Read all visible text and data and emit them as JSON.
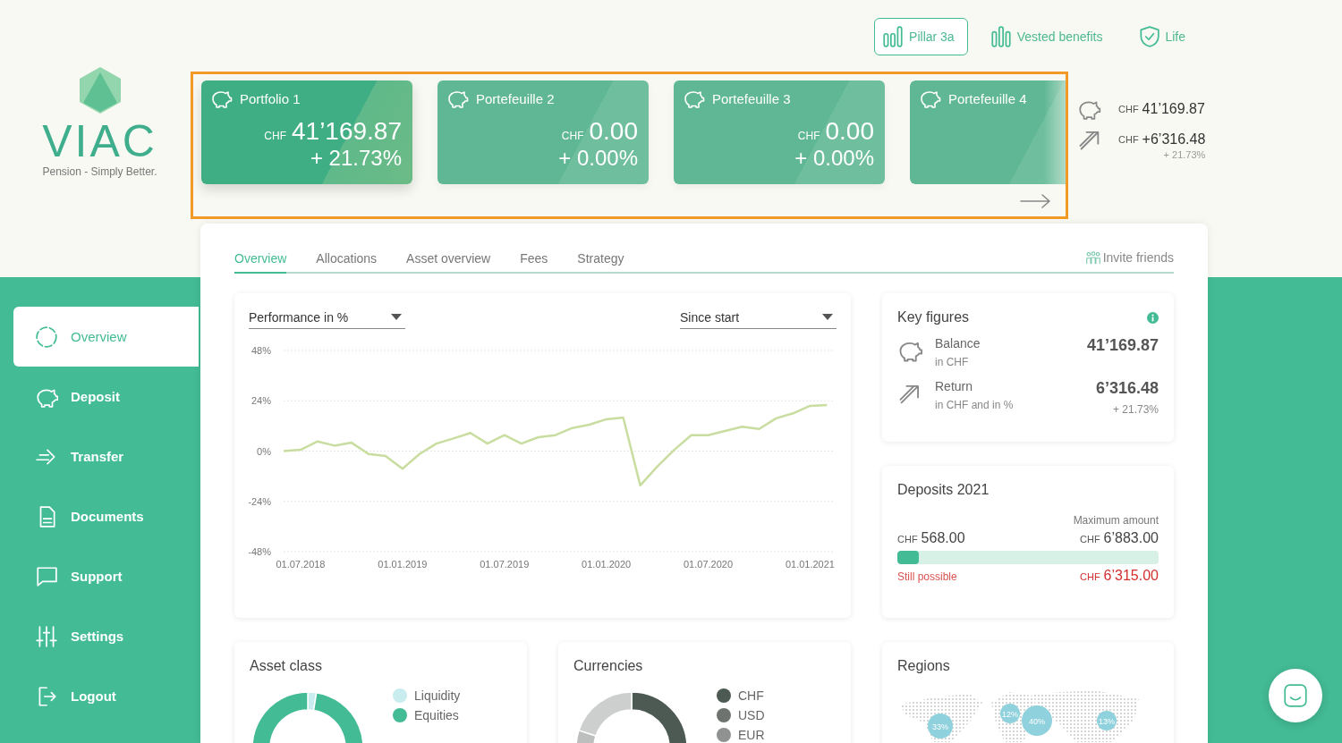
{
  "products": [
    {
      "label": "Pillar 3a",
      "kind": "pillar",
      "selected": true
    },
    {
      "label": "Vested benefits",
      "kind": "vested",
      "selected": false
    },
    {
      "label": "Life",
      "kind": "life",
      "selected": false
    }
  ],
  "logo": {
    "name": "VIAC",
    "tagline": "Pension - Simply Better."
  },
  "portfolios": [
    {
      "name": "Portfolio 1",
      "currency": "CHF",
      "amount": "41’169.87",
      "change": "+ 21.73%",
      "selected": true
    },
    {
      "name": "Portefeuille 2",
      "currency": "CHF",
      "amount": "0.00",
      "change": "+ 0.00%",
      "selected": false
    },
    {
      "name": "Portefeuille 3",
      "currency": "CHF",
      "amount": "0.00",
      "change": "+ 0.00%",
      "selected": false
    },
    {
      "name": "Portefeuille 4",
      "selected": false
    }
  ],
  "summary": {
    "balance_currency": "CHF",
    "balance": "41’169.87",
    "return_currency": "CHF",
    "return": "+6’316.48",
    "return_percent": "+ 21.73%"
  },
  "sidebar": {
    "items": [
      {
        "label": "Overview",
        "selected": true
      },
      {
        "label": "Deposit",
        "selected": false
      },
      {
        "label": "Transfer",
        "selected": false
      },
      {
        "label": "Documents",
        "selected": false
      },
      {
        "label": "Support",
        "selected": false
      },
      {
        "label": "Settings",
        "selected": false
      },
      {
        "label": "Logout",
        "selected": false
      }
    ]
  },
  "tabs": [
    {
      "label": "Overview",
      "selected": true
    },
    {
      "label": "Allocations",
      "selected": false
    },
    {
      "label": "Asset overview",
      "selected": false
    },
    {
      "label": "Fees",
      "selected": false
    },
    {
      "label": "Strategy",
      "selected": false
    }
  ],
  "invite": "Invite friends",
  "performance": {
    "metric": "Performance in %",
    "period": "Since start",
    "chart_data": {
      "type": "line",
      "categories": [
        null,
        "01.07.2018",
        null,
        null,
        null,
        null,
        null,
        "01.01.2019",
        null,
        null,
        null,
        null,
        null,
        "01.07.2019",
        null,
        null,
        null,
        null,
        null,
        "01.01.2020",
        null,
        null,
        null,
        null,
        null,
        "01.07.2020",
        null,
        null,
        null,
        null,
        null,
        "01.01.2021",
        null
      ],
      "series": [
        {
          "color": "#c8dd9f",
          "values": [
            0,
            0.6,
            4.6,
            2.6,
            4,
            -1.4,
            -2.4,
            -8.4,
            -1.4,
            3.6,
            6,
            8.6,
            3.6,
            7.6,
            3.6,
            6.6,
            7.6,
            11,
            12.6,
            15.2,
            16,
            -16.4,
            -7.4,
            0.6,
            7.6,
            7.6,
            9.6,
            11.6,
            10.6,
            15.6,
            18,
            21.6,
            22
          ]
        }
      ],
      "ylim": [
        -48,
        48
      ],
      "grid": true,
      "yticks": [
        {
          "value": 48,
          "label": "48%"
        },
        {
          "value": 24,
          "label": "24%"
        },
        {
          "value": 0,
          "label": "0%"
        },
        {
          "value": -24,
          "label": "-24%"
        },
        {
          "value": -48,
          "label": "-48%"
        }
      ]
    }
  },
  "key_figures": {
    "title": "Key figures",
    "rows": [
      {
        "label": "Balance",
        "sublabel": "in CHF",
        "value": "41’169.87"
      },
      {
        "label": "Return",
        "sublabel": "in CHF and in %",
        "value": "6’316.48",
        "change": "+ 21.73%"
      }
    ]
  },
  "deposits": {
    "title": "Deposits 2021",
    "max_label": "Maximum amount",
    "paid_currency": "CHF",
    "paid": "568.00",
    "max_currency": "CHF",
    "max": "6’883.00",
    "level": 0.083,
    "remaining_label": "Still possible",
    "remaining_currency": "CHF",
    "remaining": "6’315.00"
  },
  "asset_class": {
    "title": "Asset class",
    "legend": [
      {
        "label": "Liquidity",
        "color": "#c9ecef"
      },
      {
        "label": "Equities",
        "color": "#43bb94"
      }
    ]
  },
  "currencies": {
    "title": "Currencies",
    "legend": [
      {
        "label": "CHF",
        "color": "#4d5a53"
      },
      {
        "label": "USD",
        "color": "#6e7370"
      },
      {
        "label": "EUR",
        "color": "#8f9290"
      }
    ]
  },
  "regions": {
    "title": "Regions",
    "bubbles": [
      "33%",
      "12%",
      "40%",
      "13%"
    ]
  }
}
